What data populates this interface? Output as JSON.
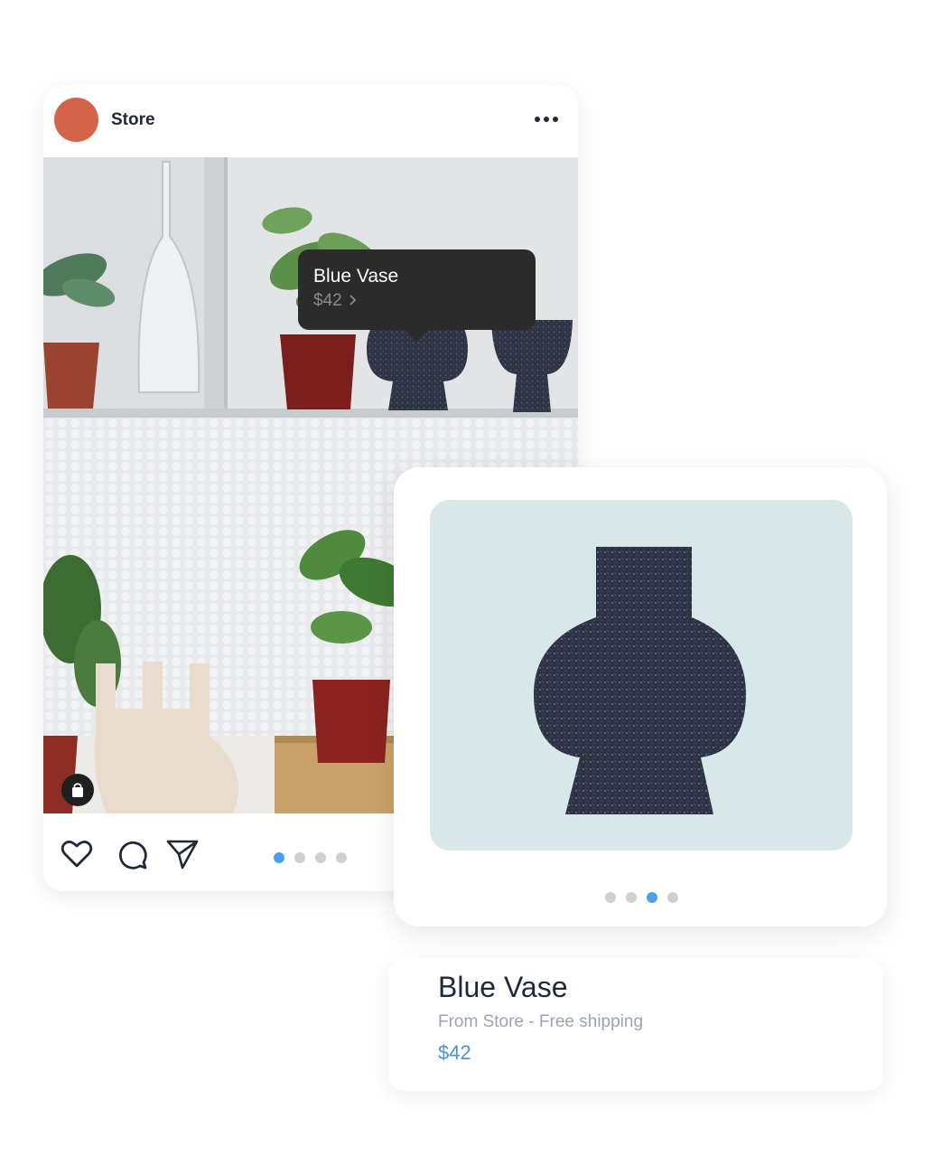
{
  "post": {
    "store_name": "Store",
    "avatar_color": "#d3644a",
    "more_icon": "more-horizontal-icon",
    "tag": {
      "name": "Blue Vase",
      "price": "$42",
      "chevron_icon": "chevron-right-icon"
    },
    "shop_icon": "shopping-bag-icon",
    "actions": {
      "like_icon": "heart-icon",
      "comment_icon": "comment-icon",
      "share_icon": "send-icon"
    },
    "carousel": {
      "count": 4,
      "active_index": 0
    }
  },
  "product_card": {
    "background_color": "#d8e7e7",
    "carousel": {
      "count": 4,
      "active_index": 2
    }
  },
  "product_info": {
    "title": "Blue Vase",
    "subtitle": "From Store - Free shipping",
    "price": "$42"
  },
  "colors": {
    "accent": "#4aa0ea",
    "price": "#4a90e2",
    "tooltip_bg": "#2b2b2b"
  }
}
